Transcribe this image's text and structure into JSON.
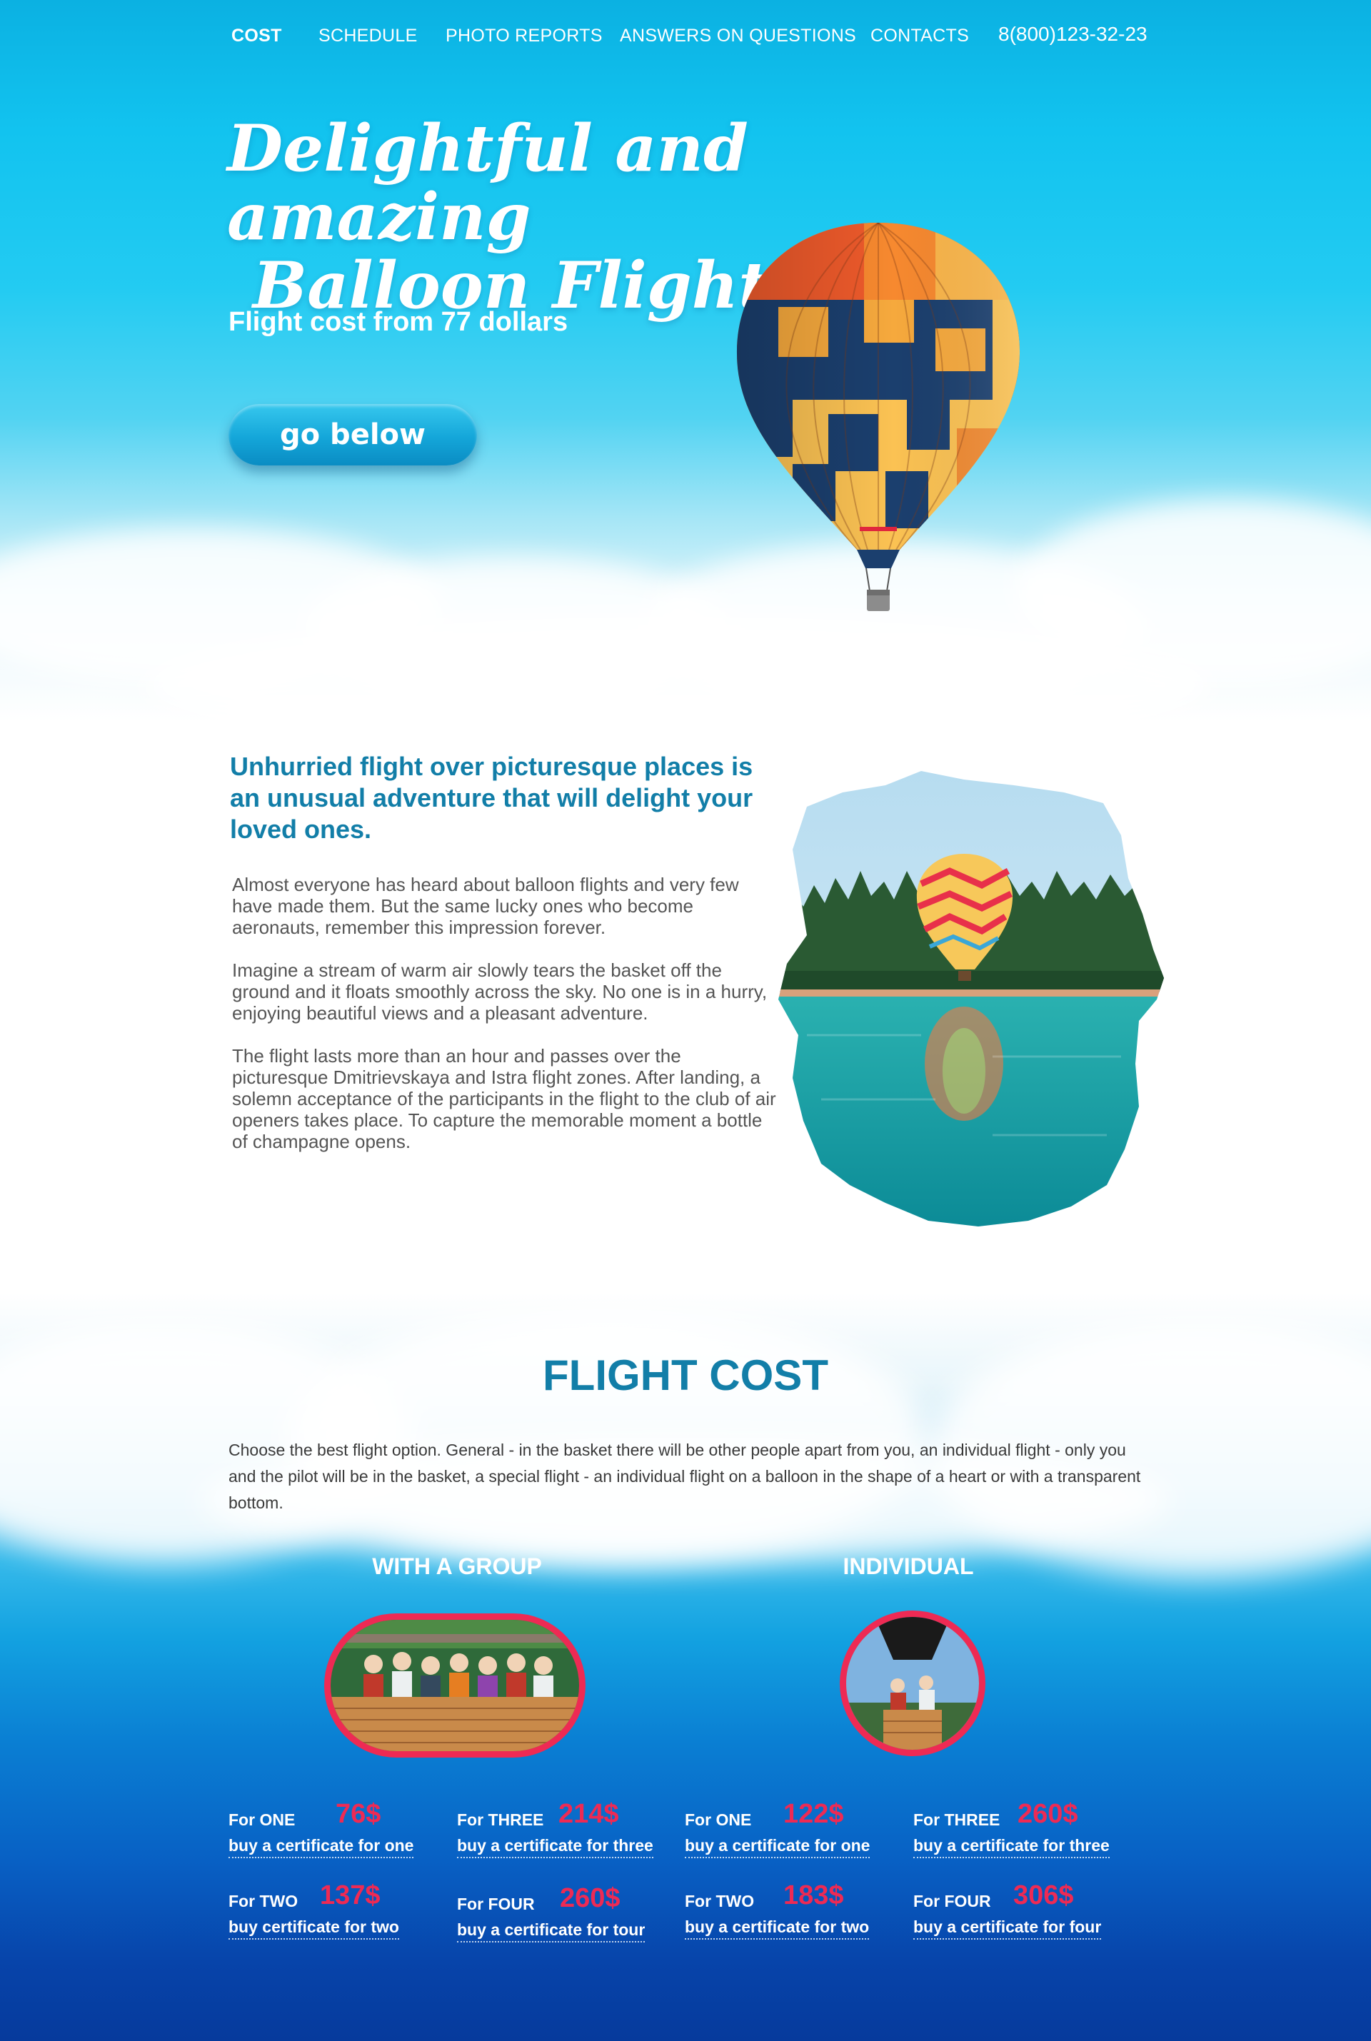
{
  "nav": {
    "items": [
      {
        "label": "COST",
        "active": true
      },
      {
        "label": "SCHEDULE"
      },
      {
        "label": "PHOTO REPORTS"
      },
      {
        "label": "ANSWERS ON QUESTIONS"
      },
      {
        "label": "CONTACTS"
      }
    ],
    "phone": "8(800)123-32-23"
  },
  "hero": {
    "title_line1": "Delightful and amazing",
    "title_line2": "Balloon Flights",
    "subtitle": "Flight cost from 77 dollars",
    "cta_label": "go below"
  },
  "about": {
    "heading": "Unhurried flight over picturesque places is an unusual adventure that will delight your loved ones.",
    "paragraphs": [
      "Almost everyone has heard about balloon flights and very few have made them. But the same lucky ones who become aeronauts, remember this impression forever.",
      "Imagine a stream of warm air slowly tears the basket off the ground and it floats smoothly across the sky. No one is in a hurry, enjoying beautiful views and a pleasant adventure.",
      "The flight lasts more than an hour and passes over the picturesque Dmitrievskaya and Istra flight zones. After landing, a solemn acceptance of the participants in the flight to the club of air openers takes place. To capture the memorable moment a bottle of champagne opens."
    ]
  },
  "cost": {
    "title": "FLIGHT COST",
    "description": "Choose the best flight option. General - in the basket there will be other people apart from you, an individual flight - only you and the pilot will be in the basket, a special flight - an individual flight on a balloon in the shape of a heart or with a transparent bottom.",
    "group": {
      "heading": "WITH A GROUP",
      "prices": [
        {
          "for": "For ONE",
          "amount": "76$",
          "buy": "buy a certificate for one"
        },
        {
          "for": "For THREE",
          "amount": "214$",
          "buy": "buy a certificate for three"
        },
        {
          "for": "For TWO",
          "amount": "137$",
          "buy": "buy certificate for two"
        },
        {
          "for": "For FOUR",
          "amount": "260$",
          "buy": "buy a certificate for tour"
        }
      ]
    },
    "individual": {
      "heading": "INDIVIDUAL",
      "prices": [
        {
          "for": "For ONE",
          "amount": "122$",
          "buy": "buy a certificate for one"
        },
        {
          "for": "For THREE",
          "amount": "260$",
          "buy": "buy a certificate for three"
        },
        {
          "for": "For TWO",
          "amount": "183$",
          "buy": "buy a certificate for two"
        },
        {
          "for": "For FOUR",
          "amount": "306$",
          "buy": "buy a certificate for four"
        }
      ]
    }
  },
  "colors": {
    "accent_red": "#ee2a54",
    "heading_teal": "#127ea8",
    "sky_blue": "#13a2e1",
    "deep_blue": "#063a9c"
  },
  "icons": [
    "hot-air-balloon-icon",
    "lake-balloon-photo",
    "group-basket-photo",
    "individual-basket-photo"
  ]
}
